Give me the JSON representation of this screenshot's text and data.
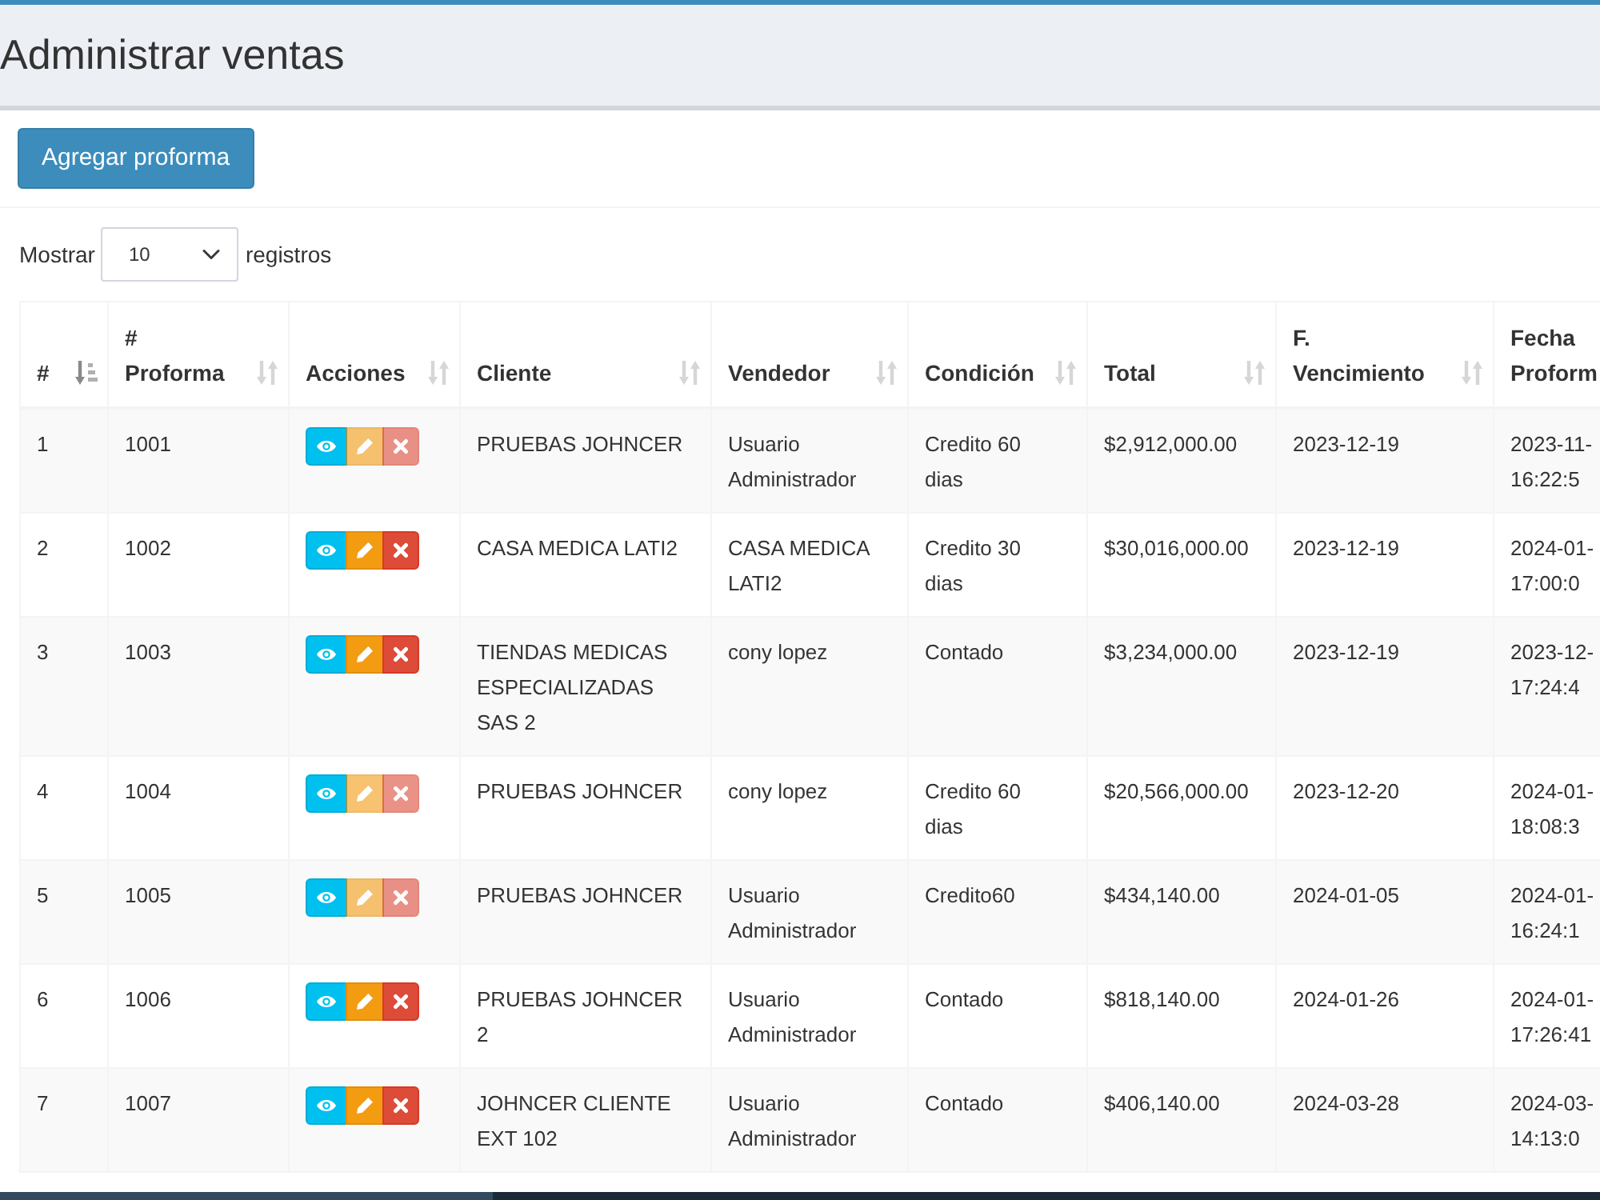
{
  "page": {
    "title": "Administrar ventas"
  },
  "toolbar": {
    "add_button": "Agregar proforma"
  },
  "length_control": {
    "prefix": "Mostrar",
    "value": "10",
    "suffix": "registros"
  },
  "table": {
    "columns": [
      {
        "label": "#",
        "sorted": true
      },
      {
        "label": "# Proforma",
        "sorted": false
      },
      {
        "label": "Acciones",
        "sorted": false
      },
      {
        "label": "Cliente",
        "sorted": false
      },
      {
        "label": "Vendedor",
        "sorted": false
      },
      {
        "label": "Condición",
        "sorted": false
      },
      {
        "label": "Total",
        "sorted": false
      },
      {
        "label": "F. Vencimiento",
        "sorted": false
      },
      {
        "label": "Fecha Proform"
      }
    ],
    "rows": [
      {
        "number": "1",
        "proforma": "1001",
        "actions": [
          {
            "kind": "view",
            "disabled": false
          },
          {
            "kind": "edit",
            "disabled": true
          },
          {
            "kind": "delete",
            "disabled": true
          }
        ],
        "cliente": "PRUEBAS JOHNCER",
        "vendedor": "Usuario Administrador",
        "condicion": "Credito 60 dias",
        "total": "$2,912,000.00",
        "vencimiento": "2023-12-19",
        "fecha": "2023-11- 16:22:5"
      },
      {
        "number": "2",
        "proforma": "1002",
        "actions": [
          {
            "kind": "view",
            "disabled": false
          },
          {
            "kind": "edit",
            "disabled": false
          },
          {
            "kind": "delete",
            "disabled": false
          }
        ],
        "cliente": "CASA MEDICA LATI2",
        "vendedor": "CASA MEDICA LATI2",
        "condicion": "Credito 30 dias",
        "total": "$30,016,000.00",
        "vencimiento": "2023-12-19",
        "fecha": "2024-01- 17:00:0"
      },
      {
        "number": "3",
        "proforma": "1003",
        "actions": [
          {
            "kind": "view",
            "disabled": false
          },
          {
            "kind": "edit",
            "disabled": false
          },
          {
            "kind": "delete",
            "disabled": false
          }
        ],
        "cliente": "TIENDAS MEDICAS ESPECIALIZADAS SAS 2",
        "vendedor": "cony lopez",
        "condicion": "Contado",
        "total": "$3,234,000.00",
        "vencimiento": "2023-12-19",
        "fecha": "2023-12- 17:24:4"
      },
      {
        "number": "4",
        "proforma": "1004",
        "actions": [
          {
            "kind": "view",
            "disabled": false
          },
          {
            "kind": "edit",
            "disabled": true
          },
          {
            "kind": "delete",
            "disabled": true
          }
        ],
        "cliente": "PRUEBAS JOHNCER",
        "vendedor": "cony lopez",
        "condicion": "Credito 60 dias",
        "total": "$20,566,000.00",
        "vencimiento": "2023-12-20",
        "fecha": "2024-01- 18:08:3"
      },
      {
        "number": "5",
        "proforma": "1005",
        "actions": [
          {
            "kind": "view",
            "disabled": false
          },
          {
            "kind": "edit",
            "disabled": true
          },
          {
            "kind": "delete",
            "disabled": true
          }
        ],
        "cliente": "PRUEBAS JOHNCER",
        "vendedor": "Usuario Administrador",
        "condicion": "Credito60",
        "total": "$434,140.00",
        "vencimiento": "2024-01-05",
        "fecha": "2024-01- 16:24:1"
      },
      {
        "number": "6",
        "proforma": "1006",
        "actions": [
          {
            "kind": "view",
            "disabled": false
          },
          {
            "kind": "edit",
            "disabled": false
          },
          {
            "kind": "delete",
            "disabled": false
          }
        ],
        "cliente": "PRUEBAS JOHNCER 2",
        "vendedor": "Usuario Administrador",
        "condicion": "Contado",
        "total": "$818,140.00",
        "vencimiento": "2024-01-26",
        "fecha": "2024-01- 17:26:41"
      },
      {
        "number": "7",
        "proforma": "1007",
        "actions": [
          {
            "kind": "view",
            "disabled": false
          },
          {
            "kind": "edit",
            "disabled": false
          },
          {
            "kind": "delete",
            "disabled": false
          }
        ],
        "cliente": "JOHNCER CLIENTE EXT 102",
        "vendedor": "Usuario Administrador",
        "condicion": "Contado",
        "total": "$406,140.00",
        "vencimiento": "2024-03-28",
        "fecha": "2024-03- 14:13:0"
      }
    ]
  }
}
